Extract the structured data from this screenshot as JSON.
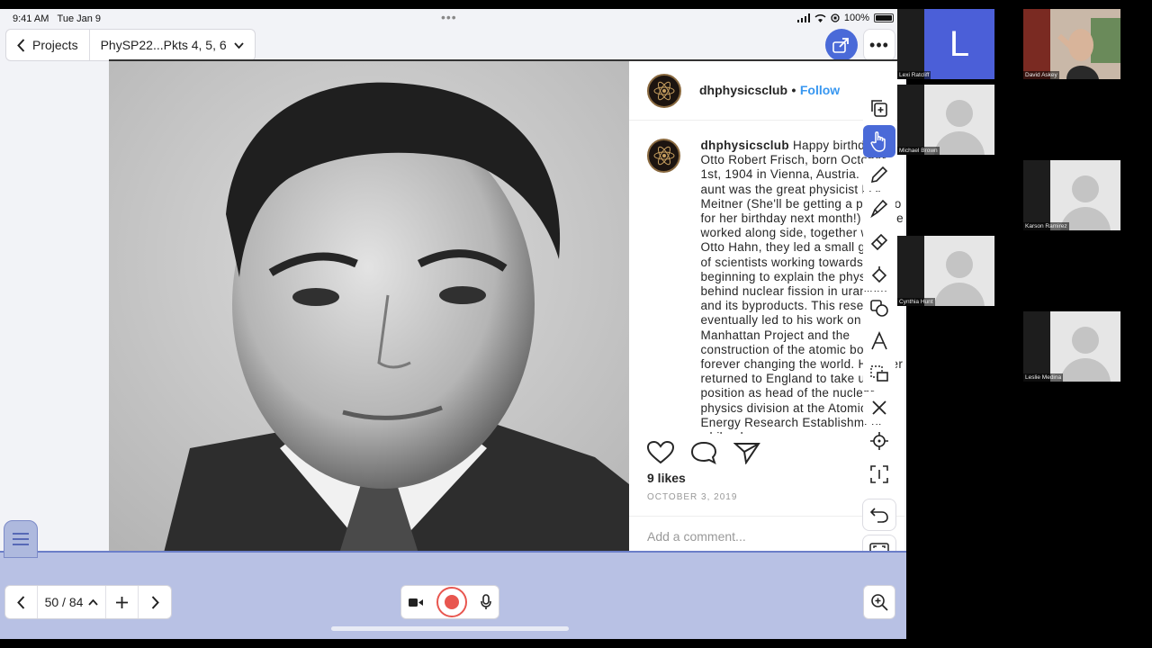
{
  "status": {
    "time": "9:41 AM",
    "date": "Tue Jan 9",
    "battery": "100%"
  },
  "toolbar": {
    "back_label": "Projects",
    "doc_title": "PhySP22...Pkts 4, 5, 6"
  },
  "post": {
    "username": "dhphysicsclub",
    "follow": "Follow",
    "caption_user": "dhphysicsclub",
    "caption_text": " Happy birthday to Otto Robert Frisch, born October 1st, 1904 in Vienna, Austria. His aunt was the great physicist Lise Meitner (She'll be getting a post too for her birthday next month!) and he worked along side, together with Otto Hahn, they led a small group of scientists working towards beginning to explain the physics behind nuclear fission in uranium and its byproducts. This research eventually led to his work on the Manhattan Project and the construction of the atomic bomb, forever changing the world. He later returned to England to take up a position as head of the nuclear physics division at the Atomic Energy Research Establishment, while also",
    "likes": "9 likes",
    "date": "OCTOBER 3, 2019",
    "comment_placeholder": "Add a comment..."
  },
  "pager": {
    "page": "50 / 84"
  },
  "participants": [
    {
      "name": "Lexi Ratcliff",
      "initial": "L"
    },
    {
      "name": "David Askey"
    },
    {
      "name": "Michael Brown"
    },
    {
      "name": "Karson Ramirez"
    },
    {
      "name": "Cynthia Hunt"
    },
    {
      "name": "Leslie Medina"
    }
  ],
  "colors": {
    "accent": "#4a6ad8",
    "bottom_bar": "#b8c1e4",
    "record": "#e8564f",
    "instagram_link": "#3897f0",
    "lexi_tile": "#4b5fd8"
  },
  "icons": [
    "back-chevron-icon",
    "chevron-down-icon",
    "share-icon",
    "more-icon",
    "copy-icon",
    "hand-icon",
    "pencil-icon",
    "marker-icon",
    "eraser-icon",
    "fill-icon",
    "shapes-icon",
    "text-icon",
    "lasso-icon",
    "close-icon",
    "laser-icon",
    "select-icon",
    "undo-icon",
    "fullscreen-icon",
    "sidebar-icon",
    "prev-icon",
    "next-icon",
    "add-page-icon",
    "video-icon",
    "record-icon",
    "mic-icon",
    "zoom-icon",
    "heart-icon",
    "comment-icon",
    "send-icon"
  ]
}
